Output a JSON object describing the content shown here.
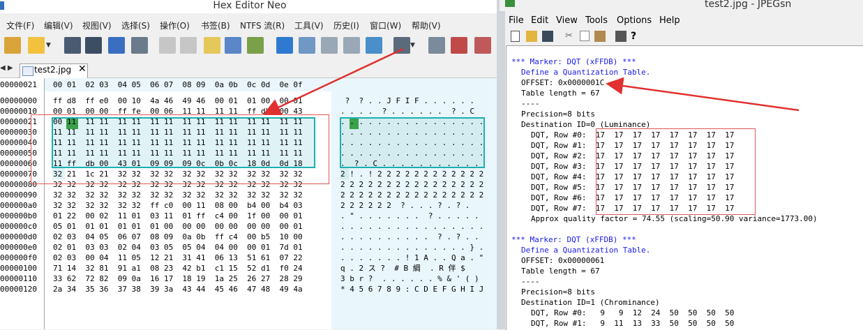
{
  "hex_editor": {
    "title": "Hex Editor Neo",
    "menu": [
      "文件(F)",
      "编辑(V)",
      "视图(V)",
      "选择(S)",
      "操作(O)",
      "书签(B)",
      "NTFS 流(R)",
      "工具(V)",
      "历史(I)",
      "窗口(W)",
      "帮助(V)"
    ],
    "tab_nav": "◀ ▶",
    "tab_label": "test2.jpg",
    "tab_close": "✕",
    "column_header_addr": "00000021",
    "column_header": "00 01  02 03  04 05  06 07  08 09  0a 0b  0c 0d  0e 0f",
    "rows": [
      {
        "addr": "00000000",
        "hex": "ff d8  ff e0  00 10  4a 46  49 46  00 01  01 00  00 01",
        "ascii": " ?  ? . . J F I F . . . . . ."
      },
      {
        "addr": "00000010",
        "hex": "00 01  00 00  ff fe  00 06  11 11  11 11  ff db  00 43",
        "ascii": ". . . .  ? . . . . . .  ? . C"
      },
      {
        "addr": "00000021",
        "hex": "00 11  11 11  11 11  11 11  11 11  11 11  11 11  11 11",
        "ascii": ". . . . . . . . . . . . . . . ."
      },
      {
        "addr": "00000030",
        "hex": "11 11  11 11  11 11  11 11  11 11  11 11  11 11  11 11",
        "ascii": ". . . . . . . . . . . . . . . ."
      },
      {
        "addr": "00000040",
        "hex": "11 11  11 11  11 11  11 11  11 11  11 11  11 11  11 11",
        "ascii": ". . . . . . . . . . . . . . . ."
      },
      {
        "addr": "00000050",
        "hex": "11 11  11 11  11 11  11 11  11 11  11 11  11 11  11 11",
        "ascii": ". . . . . . . . . . . . . . . ."
      },
      {
        "addr": "00000060",
        "hex": "11 ff  db 00  43 01  09 09  09 0c  0b 0c  18 0d  0d 18",
        "ascii": ".  ? . C . . . . . . . . . . ."
      },
      {
        "addr": "00000070",
        "hex": "32 21  1c 21  32 32  32 32  32 32  32 32  32 32  32 32",
        "ascii": "2 ! . ! 2 2 2 2 2 2 2 2 2 2 2 2"
      },
      {
        "addr": "00000080",
        "hex": "32 32  32 32  32 32  32 32  32 32  32 32  32 32  32 32",
        "ascii": "2 2 2 2 2 2 2 2 2 2 2 2 2 2 2 2"
      },
      {
        "addr": "00000090",
        "hex": "32 32  32 32  32 32  32 32  32 32  32 32  32 32  32 32",
        "ascii": "2 2 2 2 2 2 2 2 2 2 2 2 2 2 2 2"
      },
      {
        "addr": "000000a0",
        "hex": "32 32  32 32  32 32  ff c0  00 11  08 00  b4 00  b4 03",
        "ascii": "2 2 2 2 2 2  ? . . . ? . ? ."
      },
      {
        "addr": "000000b0",
        "hex": "01 22  00 02  11 01  03 11  01 ff  c4 00  1f 00  00 01",
        "ascii": ". \" . . . . . . .  ? . . . . ."
      },
      {
        "addr": "000000c0",
        "hex": "05 01  01 01  01 01  01 00  00 00  00 00  00 00  00 01",
        "ascii": ". . . . . . . . . . . . . . . ."
      },
      {
        "addr": "000000d0",
        "hex": "02 03  04 05  06 07  08 09  0a 0b  ff c4  00 b5  10 00",
        "ascii": ". . . . . . . . . .  ? . ? . ."
      },
      {
        "addr": "000000e0",
        "hex": "02 01  03 03  02 04  03 05  05 04  04 00  00 01  7d 01",
        "ascii": ". . . . . . . . . . . . . . } ."
      },
      {
        "addr": "000000f0",
        "hex": "02 03  00 04  11 05  12 21  31 41  06 13  51 61  07 22",
        "ascii": ". . . . . . . ! 1 A . . Q a . \""
      },
      {
        "addr": "00000100",
        "hex": "71 14  32 81  91 a1  08 23  42 b1  c1 15  52 d1  f0 24",
        "ascii": "q . 2 ス ?  # B 綢  . R 伴 $"
      },
      {
        "addr": "00000110",
        "hex": "33 62  72 82  09 0a  16 17  18 19  1a 25  26 27  28 29",
        "ascii": "3 b r ?  . . . . . . % & ' ( )"
      },
      {
        "addr": "00000120",
        "hex": "2a 34  35 36  37 38  39 3a  43 44  45 46  47 48  49 4a",
        "ascii": "* 4 5 6 7 8 9 : C D E F G H I J"
      }
    ]
  },
  "jpegsnoop": {
    "title": "test2.jpg - JPEGsn",
    "menu": [
      "File",
      "Edit",
      "View",
      "Tools",
      "Options",
      "Help"
    ],
    "lines": [
      {
        "text": "*** Marker: DQT (xFFDB) ***",
        "color": "blue",
        "indent": 0
      },
      {
        "text": "Define a Quantization Table.",
        "color": "blue",
        "indent": 2
      },
      {
        "text": "OFFSET: 0x0000001C",
        "color": "dark",
        "indent": 2
      },
      {
        "text": "Table length = 67",
        "color": "dark",
        "indent": 2
      },
      {
        "text": "----",
        "color": "dark",
        "indent": 2
      },
      {
        "text": "Precision=8 bits",
        "color": "dark",
        "indent": 2
      },
      {
        "text": "Destination ID=0 (Luminance)",
        "color": "dark",
        "indent": 2
      },
      {
        "text": "DQT, Row #0:  17  17  17  17  17  17  17  17",
        "color": "dark",
        "indent": 4
      },
      {
        "text": "DQT, Row #1:  17  17  17  17  17  17  17  17",
        "color": "dark",
        "indent": 4
      },
      {
        "text": "DQT, Row #2:  17  17  17  17  17  17  17  17",
        "color": "dark",
        "indent": 4
      },
      {
        "text": "DQT, Row #3:  17  17  17  17  17  17  17  17",
        "color": "dark",
        "indent": 4
      },
      {
        "text": "DQT, Row #4:  17  17  17  17  17  17  17  17",
        "color": "dark",
        "indent": 4
      },
      {
        "text": "DQT, Row #5:  17  17  17  17  17  17  17  17",
        "color": "dark",
        "indent": 4
      },
      {
        "text": "DQT, Row #6:  17  17  17  17  17  17  17  17",
        "color": "dark",
        "indent": 4
      },
      {
        "text": "DQT, Row #7:  17  17  17  17  17  17  17  17",
        "color": "dark",
        "indent": 4
      },
      {
        "text": "Approx quality factor = 74.55 (scaling=50.90 variance=1773.00)",
        "color": "dark",
        "indent": 4
      },
      {
        "text": "",
        "color": "dark",
        "indent": 0
      },
      {
        "text": "*** Marker: DQT (xFFDB) ***",
        "color": "blue",
        "indent": 0
      },
      {
        "text": "Define a Quantization Table.",
        "color": "blue",
        "indent": 2
      },
      {
        "text": "OFFSET: 0x00000061",
        "color": "dark",
        "indent": 2
      },
      {
        "text": "Table length = 67",
        "color": "dark",
        "indent": 2
      },
      {
        "text": "----",
        "color": "dark",
        "indent": 2
      },
      {
        "text": "Precision=8 bits",
        "color": "dark",
        "indent": 2
      },
      {
        "text": "Destination ID=1 (Chrominance)",
        "color": "dark",
        "indent": 2
      },
      {
        "text": "DQT, Row #0:   9   9  12  24  50  50  50  50",
        "color": "dark",
        "indent": 4
      },
      {
        "text": "DQT, Row #1:   9  11  13  33  50  50  50  50",
        "color": "dark",
        "indent": 4
      }
    ]
  },
  "colors": {
    "selection_border": "#1bb0b0",
    "highlight_byte": "#3aa04a",
    "annotation_red": "#e03030",
    "marker_blue": "#1a1ae6"
  }
}
